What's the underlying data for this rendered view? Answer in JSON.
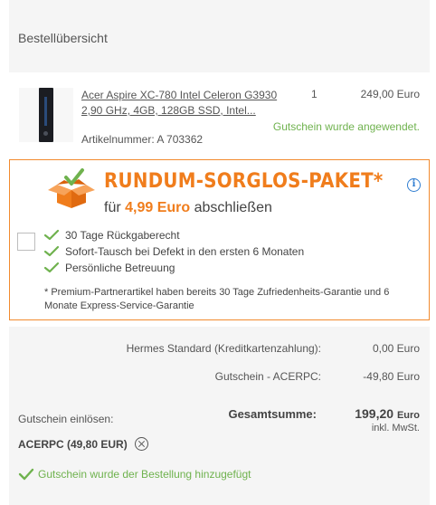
{
  "header": {
    "title": "Bestellübersicht"
  },
  "item": {
    "name": "Acer Aspire XC-780 Intel Celeron G3930 2,90 GHz, 4GB, 128GB SSD, Intel...",
    "quantity": "1",
    "price": "249,00 Euro",
    "voucher_note": "Gutschein wurde angewendet.",
    "article_number": "Artikelnummer: A 703362"
  },
  "offer": {
    "title": "RUNDUM-SORGLOS-PAKET*",
    "sub_prefix": "für",
    "sub_amount": "4,99 Euro",
    "sub_suffix": "abschließen",
    "benefits": [
      "30 Tage Rückgaberecht",
      "Sofort-Tausch bei Defekt in den ersten 6 Monaten",
      "Persönliche Betreuung"
    ],
    "footnote": "* Premium-Partnerartikel haben bereits 30 Tage Zufriedenheits-Garantie und 6 Monate Express-Service-Garantie",
    "accent_color": "#f07d1c"
  },
  "summary": {
    "shipping_label": "Hermes Standard (Kreditkartenzahlung):",
    "shipping_value": "0,00 Euro",
    "voucher_label": "Gutschein - ACERPC:",
    "voucher_value": "-49,80 Euro",
    "total_label": "Gesamtsumme:",
    "total_amount": "199,20",
    "total_currency": "Euro",
    "tax_note": "inkl. MwSt.",
    "redeem_label": "Gutschein einlösen:",
    "voucher_code": "ACERPC (49,80 EUR)",
    "added_note": "Gutschein wurde der Bestellung hinzugefügt"
  },
  "colors": {
    "green": "#6fb24e",
    "info_blue": "#2f7dd1"
  }
}
